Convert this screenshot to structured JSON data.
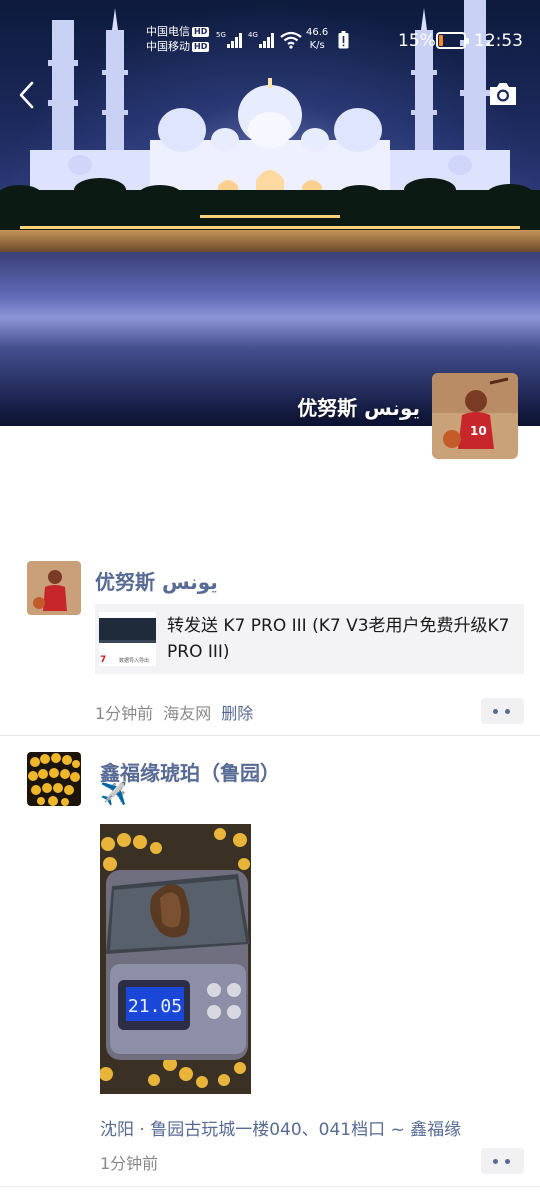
{
  "status_bar": {
    "carrier_1": "中国电信",
    "carrier_2": "中国移动",
    "hd_label": "HD",
    "signal_1_tech": "5G",
    "signal_2_tech": "4G",
    "net_speed_value": "46.6",
    "net_speed_unit": "K/s",
    "battery_percent": "15%",
    "battery_level": 0.15,
    "time": "12:53"
  },
  "cover": {
    "owner_name": "优努斯 یونس"
  },
  "posts": [
    {
      "author": "优努斯 یونس",
      "shared": {
        "thumb_caption": "数据导入导出",
        "text": "转发送 K7 PRO III (K7 V3老用户免费升级K7 PRO III)"
      },
      "time": "1分钟前",
      "source": "海友网",
      "delete_label": "删除"
    },
    {
      "author": "鑫福缘琥珀（鲁园）",
      "text": "✈️",
      "photo": {
        "scale_display": "21.05"
      },
      "location": "沈阳 · 鲁园古玩城一楼040、041档口 ~ 鑫福缘",
      "time": "1分钟前"
    }
  ],
  "colors": {
    "link": "#576b95",
    "meta": "#8a8a8a",
    "card_bg": "#f3f3f5"
  }
}
